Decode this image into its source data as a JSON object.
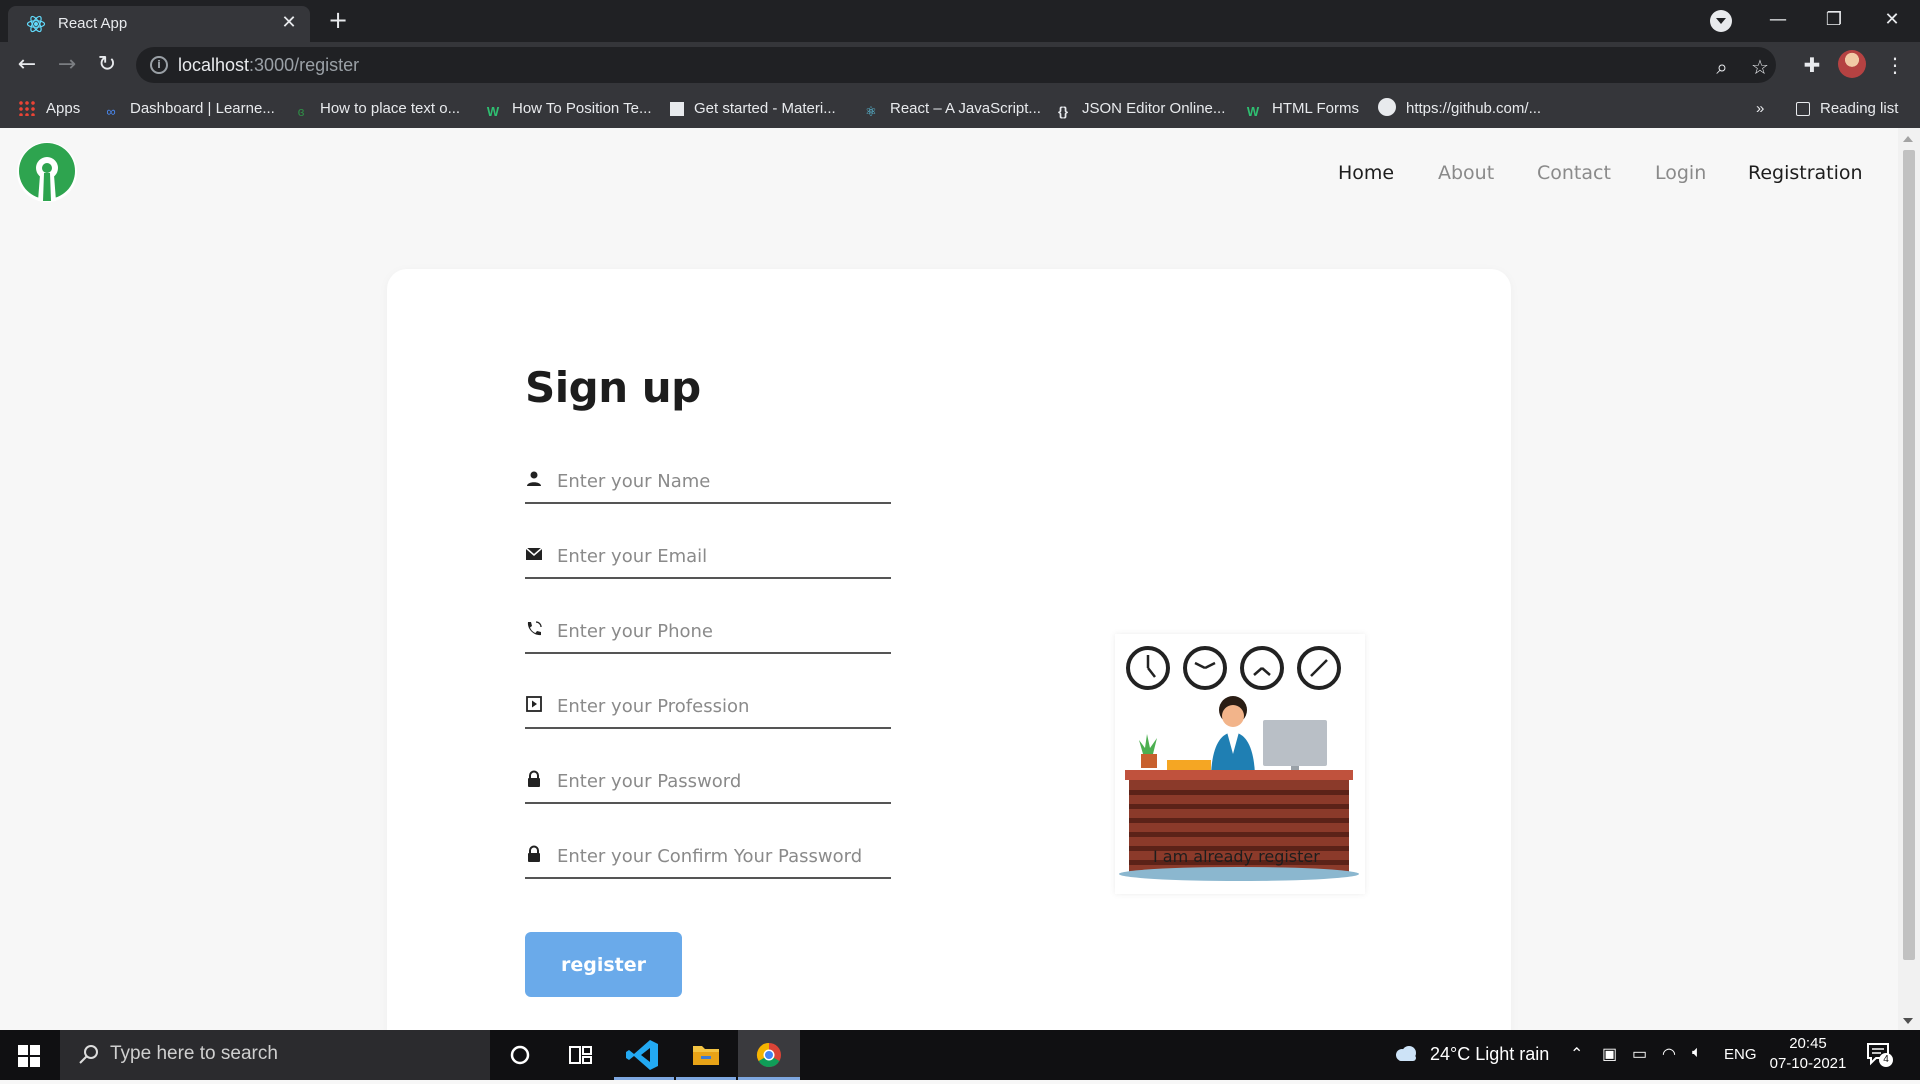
{
  "browser": {
    "tab_title": "React App",
    "tab_close": "✕",
    "new_tab": "+",
    "url_host": "localhost",
    "url_path": ":3000/register",
    "reading_list": "Reading list",
    "bookmarks_overflow": "»",
    "bookmarks": [
      {
        "label": "Apps",
        "icon": "apps-grid-icon"
      },
      {
        "label": "Dashboard | Learne...",
        "icon": "infinity-icon"
      },
      {
        "label": "How to place text o...",
        "icon": "gfg-icon"
      },
      {
        "label": "How To Position Te...",
        "icon": "w3-icon"
      },
      {
        "label": "Get started - Materi...",
        "icon": "material-icon"
      },
      {
        "label": "React – A JavaScript...",
        "icon": "react-icon"
      },
      {
        "label": "JSON Editor Online...",
        "icon": "json-icon"
      },
      {
        "label": "HTML Forms",
        "icon": "w3-icon"
      },
      {
        "label": "https://github.com/...",
        "icon": "github-icon"
      }
    ]
  },
  "site": {
    "nav": [
      {
        "label": "Home",
        "active": true
      },
      {
        "label": "About",
        "active": false
      },
      {
        "label": "Contact",
        "active": false
      },
      {
        "label": "Login",
        "active": false
      },
      {
        "label": "Registration",
        "active": true
      }
    ]
  },
  "form": {
    "title": "Sign up",
    "fields": [
      {
        "placeholder": "Enter your Name",
        "icon": "person-icon"
      },
      {
        "placeholder": "Enter your Email",
        "icon": "mail-icon"
      },
      {
        "placeholder": "Enter your Phone",
        "icon": "phone-icon"
      },
      {
        "placeholder": "Enter your Profession",
        "icon": "profession-icon"
      },
      {
        "placeholder": "Enter your Password",
        "icon": "lock-icon"
      },
      {
        "placeholder": "Enter your Confirm Your Password",
        "icon": "lock-icon"
      }
    ],
    "submit_label": "register",
    "already_registered": "I am already register"
  },
  "taskbar": {
    "search_placeholder": "Type here to search",
    "weather": "24°C  Light rain",
    "language": "ENG",
    "time": "20:45",
    "date": "07-10-2021",
    "notification_count": "4"
  }
}
